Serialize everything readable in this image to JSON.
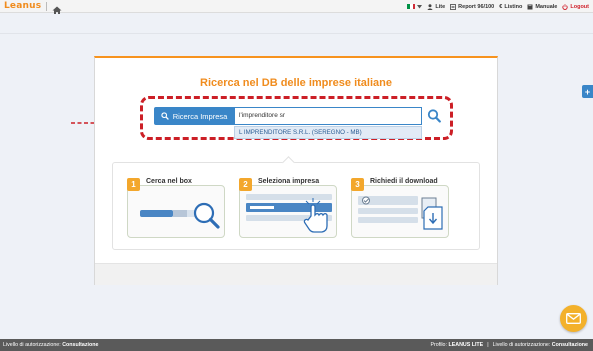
{
  "topbar": {
    "logo": "Leanus",
    "flag_colors": [
      "#009246",
      "#ffffff",
      "#ce2b37"
    ],
    "user_label": "Lite",
    "report_label": "Report 96/100",
    "listino_label": "Listino",
    "manuale_label": "Manuale",
    "logout_label": "Logout"
  },
  "panel": {
    "title": "Ricerca nel DB delle imprese italiane",
    "search_button_label": "Ricerca Impresa",
    "search_value": "l'imprenditore sr",
    "suggestion": "L IMPRENDITORE S.R.L. (SEREGNO - MB)"
  },
  "steps": [
    {
      "number": "1",
      "title": "Cerca nel box"
    },
    {
      "number": "2",
      "title": "Seleziona impresa"
    },
    {
      "number": "3",
      "title": "Richiedi il download"
    }
  ],
  "statusbar": {
    "left_label": "Livello di autorizzazione:",
    "left_value": "Consultazione",
    "profile_label": "Profilo:",
    "profile_value": "LEANUS LITE",
    "right_label": "Livello di autorizzazione:",
    "right_value": "Consultazione"
  },
  "side": {
    "plus_label": "+"
  },
  "colors": {
    "accent": "#f08c1e",
    "blue": "#3a86c8",
    "red": "#cc1f26",
    "mail": "#f3b12b"
  }
}
